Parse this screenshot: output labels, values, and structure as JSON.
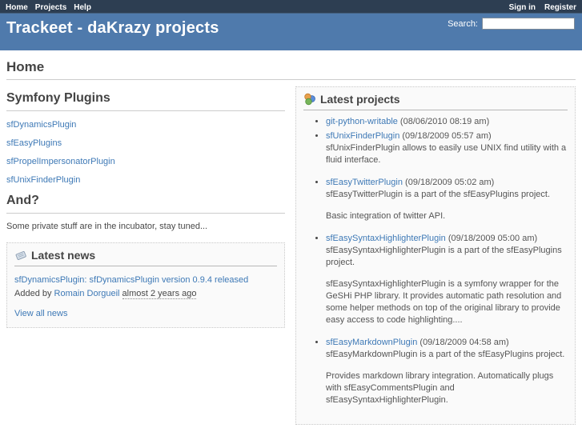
{
  "colors": {
    "topbar_bg": "#2d3e52",
    "header_bg": "#4f7aac",
    "link_color": "#3e79b6",
    "heading_color": "#444444"
  },
  "top_menu": {
    "left": [
      {
        "label": "Home"
      },
      {
        "label": "Projects"
      },
      {
        "label": "Help"
      }
    ],
    "right": [
      {
        "label": "Sign in"
      },
      {
        "label": "Register"
      }
    ]
  },
  "header": {
    "title": "Trackeet - daKrazy projects",
    "search_label": "Search:",
    "search_value": ""
  },
  "page": {
    "title": "Home"
  },
  "left_column": {
    "plugins_heading": "Symfony Plugins",
    "plugin_links": [
      "sfDynamicsPlugin",
      "sfEasyPlugins",
      "sfPropelImpersonatorPlugin",
      "sfUnixFinderPlugin"
    ],
    "and_heading": "And?",
    "and_text": "Some private stuff are in the incubator, stay tuned...",
    "news_box": {
      "title": "Latest news",
      "icon": "news-icon",
      "item": {
        "link": "sfDynamicsPlugin: sfDynamicsPlugin version 0.9.4 released",
        "added_by_prefix": "Added by",
        "author": "Romain Dorgueil",
        "ago": "almost 2 years ago"
      },
      "view_all": "View all news"
    }
  },
  "projects_box": {
    "title": "Latest projects",
    "icon": "projects-icon",
    "items": [
      {
        "name": "git-python-writable",
        "date": "(08/06/2010 08:19 am)",
        "desc": []
      },
      {
        "name": "sfUnixFinderPlugin",
        "date": "(09/18/2009 05:57 am)",
        "desc": [
          "sfUnixFinderPlugin allows to easily use UNIX find utility with a fluid interface."
        ]
      },
      {
        "name": "sfEasyTwitterPlugin",
        "date": "(09/18/2009 05:02 am)",
        "desc": [
          "sfEasyTwitterPlugin is a part of the sfEasyPlugins project.",
          "Basic integration of twitter API."
        ]
      },
      {
        "name": "sfEasySyntaxHighlighterPlugin",
        "date": "(09/18/2009 05:00 am)",
        "desc": [
          "sfEasySyntaxHighlighterPlugin is a part of the sfEasyPlugins project.",
          "sfEasySyntaxHighlighterPlugin is a symfony wrapper for the GeSHi PHP library. It provides automatic path resolution and some helper methods on top of the original library to provide easy access to code highlighting...."
        ]
      },
      {
        "name": "sfEasyMarkdownPlugin",
        "date": "(09/18/2009 04:58 am)",
        "desc": [
          "sfEasyMarkdownPlugin is a part of the sfEasyPlugins project.",
          "Provides markdown library integration. Automatically plugs with sfEasyCommentsPlugin and sfEasySyntaxHighlighterPlugin."
        ]
      }
    ]
  }
}
